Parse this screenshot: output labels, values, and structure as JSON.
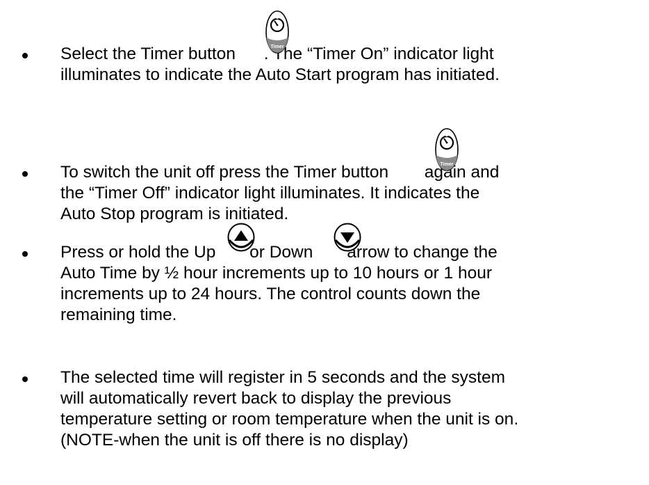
{
  "items": [
    {
      "lines": [
        {
          "pre": "Select the Timer button ",
          "post": ". The “Timer On” indicator light"
        },
        {
          "text": "illuminates to indicate the Auto Start program has initiated."
        }
      ]
    },
    {
      "lines": [
        {
          "pre": "To switch the unit off press the Timer button ",
          "post": " again and"
        },
        {
          "text": "the “Timer Off” indicator light illuminates. It indicates the"
        },
        {
          "text": "Auto Stop program is initiated."
        }
      ]
    },
    {
      "lines": [
        {
          "pre": "Press or hold the Up",
          "mid": " or Down",
          "post": " arrow to change the"
        },
        {
          "text": "Auto Time by ½ hour increments up to 10 hours or 1 hour"
        },
        {
          "text": "increments up to 24 hours. The control counts down the"
        },
        {
          "text": "remaining time."
        }
      ]
    },
    {
      "lines": [
        {
          "text": "The selected time will register in 5 seconds and the system"
        },
        {
          "text": "will automatically revert back to display the previous"
        },
        {
          "text": "temperature setting or room temperature when the unit is on."
        },
        {
          "text": "(NOTE-when the unit is off there is no display)"
        }
      ]
    }
  ],
  "icons": {
    "timer_label": "Timer",
    "timer_icon": "timer-button-icon",
    "up_icon": "up-arrow-button-icon",
    "down_icon": "down-arrow-button-icon"
  },
  "colors": {
    "text": "#000000",
    "timer_gray": "#8a8a8a"
  }
}
